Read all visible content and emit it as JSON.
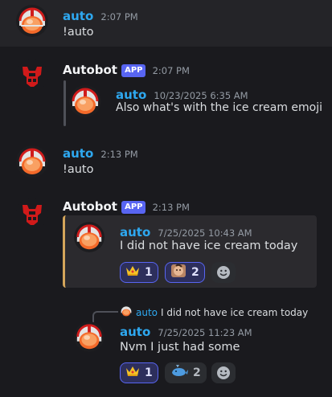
{
  "colors": {
    "user_blue": "#2ea8f0",
    "bot_white": "#f2f3f5",
    "app_badge": "#5865f2",
    "embed_border": "#d4a55a"
  },
  "messages": [
    {
      "author": "auto",
      "time": "2:07 PM",
      "text": "!auto"
    },
    {
      "author": "Autobot",
      "badge": "APP",
      "time": "2:07 PM",
      "quoted": {
        "author": "auto",
        "time": "10/23/2025 6:35 AM",
        "text": "Also what's with the ice cream emoji"
      }
    },
    {
      "author": "auto",
      "time": "2:13 PM",
      "text": "!auto"
    },
    {
      "author": "Autobot",
      "badge": "APP",
      "time": "2:13 PM",
      "embed": {
        "author": "auto",
        "time": "7/25/2025 10:43 AM",
        "text": "I did not have ice cream today",
        "reactions": [
          {
            "emoji": "crown",
            "count": "1"
          },
          {
            "emoji": "face",
            "count": "2"
          }
        ]
      },
      "reply": {
        "author": "auto",
        "text": "I did not have ice cream today"
      },
      "quoted": {
        "author": "auto",
        "time": "7/25/2025 11:23 AM",
        "text": "Nvm I just had some",
        "reactions": [
          {
            "emoji": "crown",
            "count": "1"
          },
          {
            "emoji": "whale",
            "count": "2"
          }
        ]
      }
    }
  ]
}
